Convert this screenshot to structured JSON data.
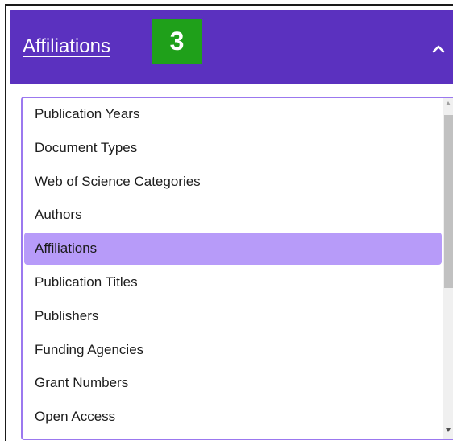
{
  "header": {
    "title": "Affiliations",
    "badge": "3",
    "collapse_icon": "chevron-up-icon"
  },
  "list": {
    "items": [
      {
        "label": "Publication Years",
        "selected": false
      },
      {
        "label": "Document Types",
        "selected": false
      },
      {
        "label": "Web of Science Categories",
        "selected": false
      },
      {
        "label": "Authors",
        "selected": false
      },
      {
        "label": "Affiliations",
        "selected": true
      },
      {
        "label": "Publication Titles",
        "selected": false
      },
      {
        "label": "Publishers",
        "selected": false
      },
      {
        "label": "Funding Agencies",
        "selected": false
      },
      {
        "label": "Grant Numbers",
        "selected": false
      },
      {
        "label": "Open Access",
        "selected": false
      }
    ]
  },
  "colors": {
    "header_bg": "#5b31bf",
    "badge_bg": "#1fa01a",
    "selected_bg": "#b79bf9",
    "list_border": "#9b78ef"
  }
}
